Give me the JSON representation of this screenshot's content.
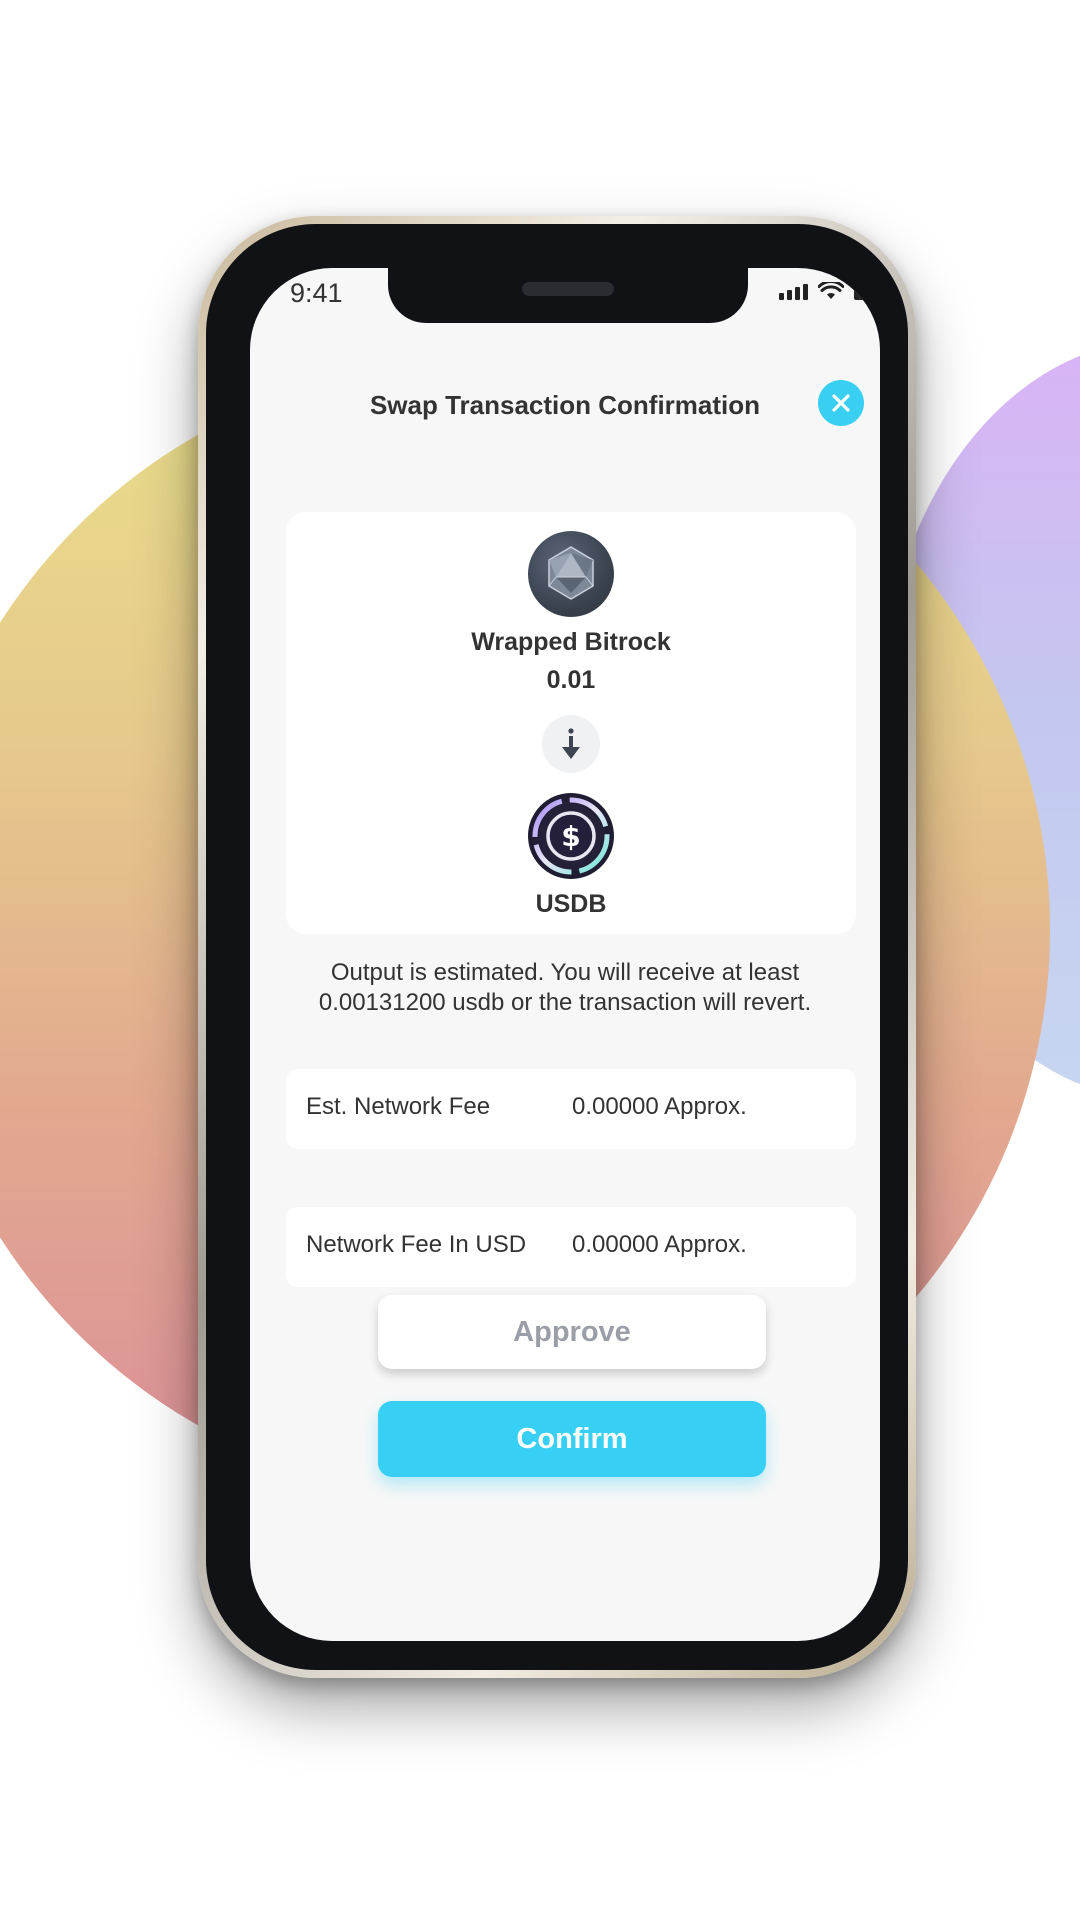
{
  "status_bar": {
    "time": "9:41"
  },
  "dialog": {
    "title": "Swap Transaction Confirmation",
    "close_icon": "close-icon"
  },
  "swap": {
    "from": {
      "name": "Wrapped Bitrock",
      "amount": "0.01",
      "icon": "wrapped-bitrock-icon"
    },
    "arrow_icon": "arrow-down-icon",
    "to": {
      "name": "USDB",
      "icon": "usdb-dollar-icon"
    }
  },
  "notice": "Output is estimated. You will receive at least 0.00131200 usdb or the transaction will revert.",
  "fees": [
    {
      "label": "Est. Network Fee",
      "value": "0.00000 Approx."
    },
    {
      "label": "Network Fee In USD",
      "value": "0.00000 Approx."
    }
  ],
  "buttons": {
    "approve": "Approve",
    "confirm": "Confirm"
  },
  "colors": {
    "accent": "#37cff3",
    "disabled_text": "#9a9ea6"
  }
}
